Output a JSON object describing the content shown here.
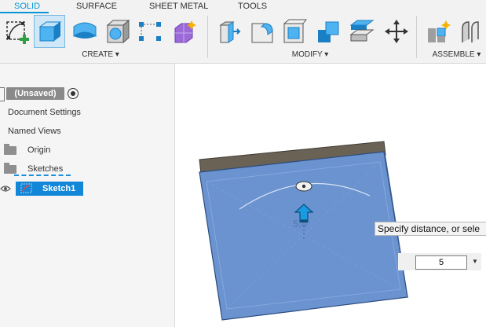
{
  "tabs": [
    {
      "label": "SOLID",
      "active": true
    },
    {
      "label": "SURFACE",
      "active": false
    },
    {
      "label": "SHEET METAL",
      "active": false
    },
    {
      "label": "TOOLS",
      "active": false
    }
  ],
  "toolbar_groups": {
    "create": "CREATE ▾",
    "modify": "MODIFY ▾",
    "assemble": "ASSEMBLE ▾"
  },
  "toolbar_icons": {
    "create": [
      "create-sketch-icon",
      "extrude-icon",
      "revolve-icon",
      "hole-icon",
      "pattern-icon",
      "create-form-icon"
    ],
    "modify": [
      "press-pull-icon",
      "fillet-icon",
      "shell-icon",
      "combine-icon",
      "offset-face-icon",
      "move-icon"
    ],
    "assemble": [
      "new-component-icon",
      "joint-icon"
    ]
  },
  "browser": {
    "document_name": "(Unsaved)",
    "items": [
      "Document Settings",
      "Named Views",
      "Origin",
      "Sketches",
      "Sketch1"
    ]
  },
  "viewport": {
    "tooltip": "Specify distance, or sele",
    "distance_value": "5",
    "ghost_label": "5.0"
  },
  "colors": {
    "accent": "#0696d7",
    "body_face": "#6a93cf",
    "body_top": "#6a6254",
    "selection": "#1287d8"
  }
}
